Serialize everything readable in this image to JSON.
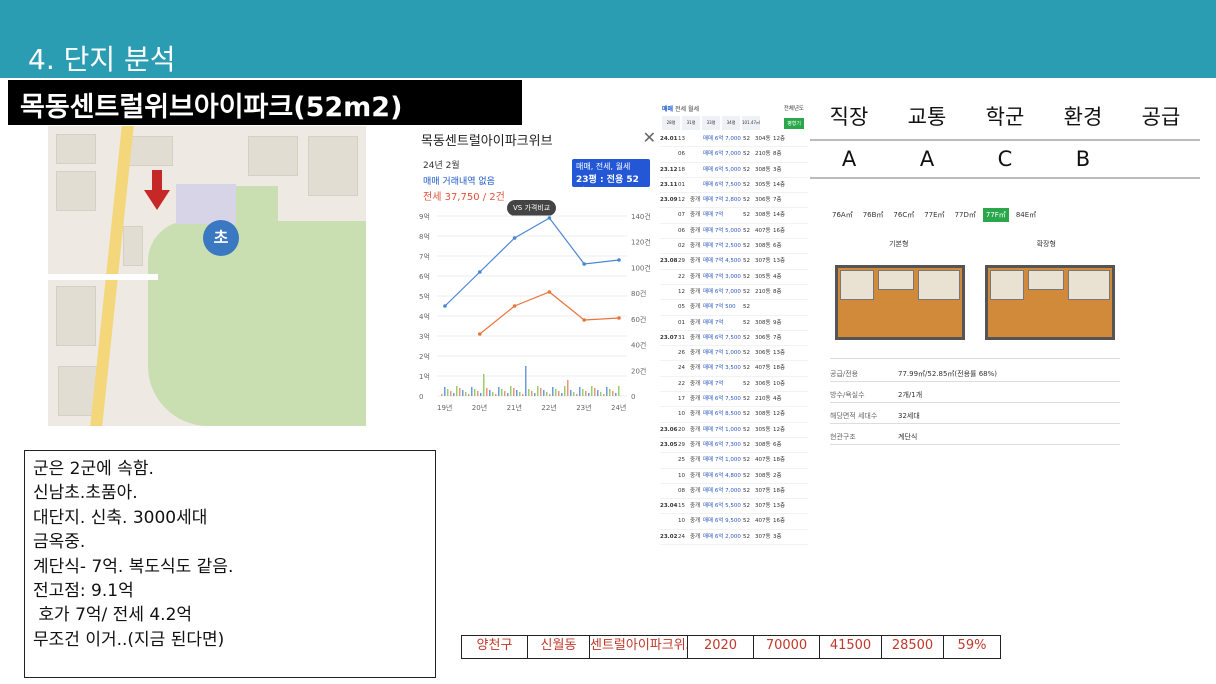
{
  "header": {
    "section_title": "4. 단지 분석"
  },
  "complex_title": "목동센트럴위브아이파크(52m2)",
  "map": {
    "marker_label": "초"
  },
  "chart_panel": {
    "title": "목동센트럴아이파크위브",
    "date": "24년 2월",
    "no_trade": "매매 거래내역 없음",
    "jeonse": "전세 37,750 / 2건",
    "filter_line1": "매매, 전세, 월세",
    "filter_line2": "23평 : 전용 52㎡",
    "vs_button": "VS 가격비교",
    "y_left_ticks": [
      "9억",
      "8억",
      "7억",
      "6억",
      "5억",
      "4억",
      "3억",
      "2억",
      "1억",
      "0"
    ],
    "y_right_ticks": [
      "140건",
      "120건",
      "100건",
      "80건",
      "60건",
      "40건",
      "20건",
      "0"
    ],
    "x_ticks": [
      "19년",
      "20년",
      "21년",
      "22년",
      "23년",
      "24년"
    ]
  },
  "chart_data": {
    "type": "line",
    "x": [
      "19년",
      "20년",
      "21년",
      "22년",
      "23년",
      "24년"
    ],
    "ylim": [
      0,
      9
    ],
    "series": [
      {
        "values": [
          4.5,
          6.2,
          7.9,
          8.9,
          6.6,
          6.8
        ]
      },
      {
        "values": [
          null,
          3.1,
          4.5,
          5.2,
          3.8,
          3.9
        ]
      }
    ]
  },
  "listing": {
    "tabs": [
      "매매",
      "전세",
      "월세"
    ],
    "sort": "전체년도",
    "years": [
      "28평",
      "31평",
      "33평",
      "34평",
      "101.47㎡"
    ],
    "btn": "평형기",
    "rows": [
      {
        "date": "24.01",
        "day": "13",
        "type": "",
        "price": "매매 6억 7,000",
        "area": "52",
        "dong": "304동",
        "floor": "12층"
      },
      {
        "date": "",
        "day": "06",
        "type": "",
        "price": "매매 6억 7,000",
        "area": "52",
        "dong": "210동",
        "floor": "8층"
      },
      {
        "date": "23.12",
        "day": "18",
        "type": "",
        "price": "매매 6억 5,000",
        "area": "52",
        "dong": "308동",
        "floor": "3층"
      },
      {
        "date": "23.11",
        "day": "01",
        "type": "",
        "price": "매매 6억 7,500",
        "area": "52",
        "dong": "305동",
        "floor": "14층"
      },
      {
        "date": "23.09",
        "day": "12",
        "type": "중개",
        "price": "매매 7억 2,800",
        "area": "52",
        "dong": "306동",
        "floor": "7층"
      },
      {
        "date": "",
        "day": "07",
        "type": "중개",
        "price": "매매 7억",
        "area": "52",
        "dong": "308동",
        "floor": "14층"
      },
      {
        "date": "",
        "day": "06",
        "type": "중개",
        "price": "매매 7억 5,000",
        "area": "52",
        "dong": "407동",
        "floor": "16층"
      },
      {
        "date": "",
        "day": "02",
        "type": "중개",
        "price": "매매 7억 2,500",
        "area": "52",
        "dong": "308동",
        "floor": "6층"
      },
      {
        "date": "23.08",
        "day": "29",
        "type": "중개",
        "price": "매매 7억 4,500",
        "area": "52",
        "dong": "307동",
        "floor": "13층"
      },
      {
        "date": "",
        "day": "22",
        "type": "중개",
        "price": "매매 7억 3,000",
        "area": "52",
        "dong": "305동",
        "floor": "4층"
      },
      {
        "date": "",
        "day": "12",
        "type": "중개",
        "price": "매매 6억 7,000",
        "area": "52",
        "dong": "210동",
        "floor": "8층"
      },
      {
        "date": "",
        "day": "05",
        "type": "중개",
        "price": "매매 7억 500",
        "area": "52",
        "dong": "",
        "floor": ""
      },
      {
        "date": "",
        "day": "01",
        "type": "중개",
        "price": "매매 7억",
        "area": "52",
        "dong": "308동",
        "floor": "9층"
      },
      {
        "date": "23.07",
        "day": "31",
        "type": "중개",
        "price": "매매 6억 7,500",
        "area": "52",
        "dong": "306동",
        "floor": "7층"
      },
      {
        "date": "",
        "day": "26",
        "type": "중개",
        "price": "매매 7억 1,000",
        "area": "52",
        "dong": "306동",
        "floor": "13층"
      },
      {
        "date": "",
        "day": "24",
        "type": "중개",
        "price": "매매 7억 3,500",
        "area": "52",
        "dong": "407동",
        "floor": "18층"
      },
      {
        "date": "",
        "day": "22",
        "type": "중개",
        "price": "매매 7억",
        "area": "52",
        "dong": "306동",
        "floor": "10층"
      },
      {
        "date": "",
        "day": "17",
        "type": "중개",
        "price": "매매 6억 7,500",
        "area": "52",
        "dong": "210동",
        "floor": "4층"
      },
      {
        "date": "",
        "day": "10",
        "type": "중개",
        "price": "매매 6억 8,500",
        "area": "52",
        "dong": "308동",
        "floor": "12층"
      },
      {
        "date": "23.06",
        "day": "20",
        "type": "중개",
        "price": "매매 7억 1,000",
        "area": "52",
        "dong": "305동",
        "floor": "12층"
      },
      {
        "date": "23.05",
        "day": "29",
        "type": "중개",
        "price": "매매 6억 7,300",
        "area": "52",
        "dong": "308동",
        "floor": "6층"
      },
      {
        "date": "",
        "day": "25",
        "type": "중개",
        "price": "매매 7억 1,000",
        "area": "52",
        "dong": "407동",
        "floor": "18층"
      },
      {
        "date": "",
        "day": "10",
        "type": "중개",
        "price": "매매 6억 4,800",
        "area": "52",
        "dong": "308동",
        "floor": "2층"
      },
      {
        "date": "",
        "day": "08",
        "type": "중개",
        "price": "매매 6억 7,000",
        "area": "52",
        "dong": "307동",
        "floor": "18층"
      },
      {
        "date": "23.04",
        "day": "15",
        "type": "중개",
        "price": "매매 6억 5,500",
        "area": "52",
        "dong": "307동",
        "floor": "13층"
      },
      {
        "date": "",
        "day": "10",
        "type": "중개",
        "price": "매매 6억 9,500",
        "area": "52",
        "dong": "407동",
        "floor": "16층"
      },
      {
        "date": "23.02",
        "day": "24",
        "type": "중개",
        "price": "매매 6억 2,000",
        "area": "52",
        "dong": "307동",
        "floor": "3층"
      }
    ]
  },
  "grades": {
    "headers": [
      "직장",
      "교통",
      "학군",
      "환경",
      "공급"
    ],
    "values": [
      "A",
      "A",
      "C",
      "B",
      ""
    ]
  },
  "plan": {
    "tabs": [
      "76A㎡",
      "76B㎡",
      "76C㎡",
      "77E㎡",
      "77D㎡",
      "77F㎡",
      "84E㎡"
    ],
    "active_tab": "77F㎡",
    "label_basic": "기본형",
    "label_ext": "확장형",
    "info": [
      {
        "k": "공급/전용",
        "v": "77.99㎡/52.85㎡(전용률 68%)"
      },
      {
        "k": "방수/욕실수",
        "v": "2개/1개"
      },
      {
        "k": "해당면적 세대수",
        "v": "32세대"
      },
      {
        "k": "현관구조",
        "v": "계단식"
      }
    ]
  },
  "notes": [
    "군은 2군에 속함.",
    "신남초.초품아.",
    "대단지. 신축. 3000세대",
    "금옥중.",
    "계단식- 7억. 복도식도 같음.",
    "전고점: 9.1억",
    " 호가 7억/ 전세 4.2억",
    "무조건 이거..(지금 된다면)"
  ],
  "summary": [
    "양천구",
    "신월동",
    "센트럴아이파크위브",
    "2020",
    "70000",
    "41500",
    "28500",
    "59%"
  ],
  "colors": {
    "topbar": "#2a9db3",
    "summary_text": "#c0392b",
    "active_tab": "#2aa64b"
  }
}
